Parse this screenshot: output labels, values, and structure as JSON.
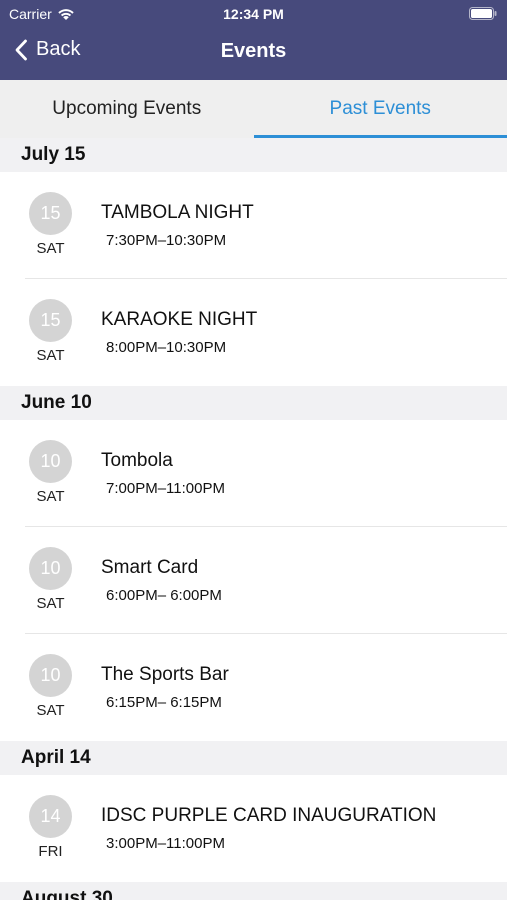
{
  "status": {
    "carrier": "Carrier",
    "time": "12:34 PM"
  },
  "nav": {
    "back_label": "Back",
    "title": "Events"
  },
  "tabs": [
    {
      "label": "Upcoming Events",
      "active": false
    },
    {
      "label": "Past Events",
      "active": true
    }
  ],
  "colors": {
    "header_bg": "#474a7c",
    "accent": "#2d8fd6",
    "badge_bg": "#d4d4d4"
  },
  "sections": [
    {
      "header": "July 15",
      "events": [
        {
          "date": "15",
          "day": "SAT",
          "title": "TAMBOLA  NIGHT",
          "time": "7:30PM–10:30PM"
        },
        {
          "date": "15",
          "day": "SAT",
          "title": "KARAOKE NIGHT",
          "time": "8:00PM–10:30PM"
        }
      ]
    },
    {
      "header": "June 10",
      "events": [
        {
          "date": "10",
          "day": "SAT",
          "title": "Tombola",
          "time": "7:00PM–11:00PM"
        },
        {
          "date": "10",
          "day": "SAT",
          "title": "Smart Card",
          "time": "6:00PM– 6:00PM"
        },
        {
          "date": "10",
          "day": "SAT",
          "title": "The Sports Bar",
          "time": "6:15PM– 6:15PM"
        }
      ]
    },
    {
      "header": "April 14",
      "events": [
        {
          "date": "14",
          "day": "FRI",
          "title": "IDSC PURPLE CARD INAUGURATION",
          "time": "3:00PM–11:00PM"
        }
      ]
    },
    {
      "header": "August 30",
      "events": []
    }
  ]
}
